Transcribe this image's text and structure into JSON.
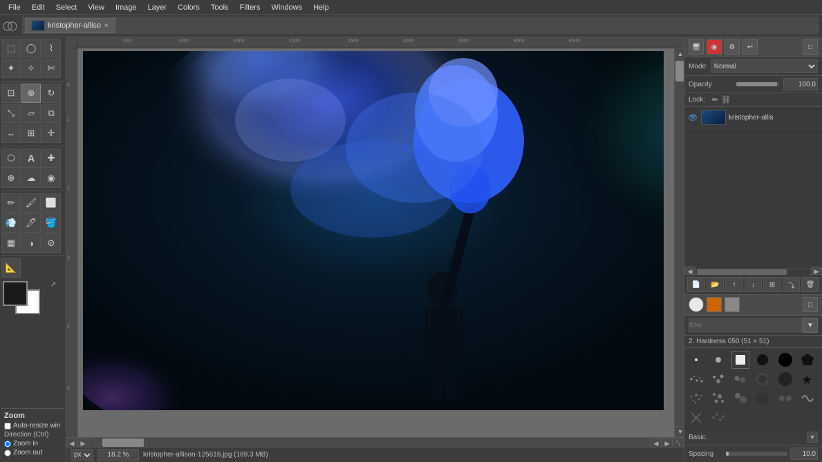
{
  "menubar": {
    "items": [
      "File",
      "Edit",
      "Select",
      "View",
      "Image",
      "Layer",
      "Colors",
      "Tools",
      "Filters",
      "Windows",
      "Help"
    ]
  },
  "toptoolbar": {
    "logo": "⬤",
    "tab": {
      "name": "kristopher-alliso",
      "close": "✕"
    }
  },
  "toolbox": {
    "tools": [
      {
        "id": "rect-select",
        "icon": "⬚"
      },
      {
        "id": "ellipse-select",
        "icon": "○"
      },
      {
        "id": "lasso",
        "icon": "⌇"
      },
      {
        "id": "fuzzy-select",
        "icon": "✦"
      },
      {
        "id": "color-select",
        "icon": "✧"
      },
      {
        "id": "crop",
        "icon": "⊡"
      },
      {
        "id": "rotate",
        "icon": "↻"
      },
      {
        "id": "scale",
        "icon": "⤡"
      },
      {
        "id": "perspective",
        "icon": "▱"
      },
      {
        "id": "flip",
        "icon": "⇔"
      },
      {
        "id": "text",
        "icon": "A"
      },
      {
        "id": "pencil",
        "icon": "✏"
      },
      {
        "id": "brush",
        "icon": "🖌"
      },
      {
        "id": "eraser",
        "icon": "⬜"
      },
      {
        "id": "fill",
        "icon": "🪣"
      },
      {
        "id": "gradient",
        "icon": "▦"
      },
      {
        "id": "heal",
        "icon": "✚"
      },
      {
        "id": "clone",
        "icon": "✲"
      },
      {
        "id": "blur",
        "icon": "◉"
      },
      {
        "id": "dodge",
        "icon": "◑"
      },
      {
        "id": "smudge",
        "icon": "☁"
      },
      {
        "id": "measure",
        "icon": "⬟"
      },
      {
        "id": "zoom",
        "icon": "⊕"
      },
      {
        "id": "hand",
        "icon": "✋"
      },
      {
        "id": "move",
        "icon": "✛"
      },
      {
        "id": "path",
        "icon": "⬡"
      },
      {
        "id": "colorpick",
        "icon": "⊘"
      }
    ],
    "fgColor": "#1a1a1a",
    "bgColor": "#ffffff"
  },
  "zoom": {
    "title": "Zoom",
    "autoresize_label": "Auto-resize win",
    "direction_label": "Direction  (Ctrl)",
    "zoom_in_label": "Zoom in",
    "zoom_out_label": "Zoom out"
  },
  "ruler": {
    "ticks": [
      "500",
      "1000",
      "1500",
      "2000",
      "2500",
      "3000",
      "3500",
      "4000",
      "4500"
    ]
  },
  "bottombar": {
    "unit": "px",
    "zoom": "18.2 %",
    "filename": "kristopher-allison-125616.jpg (189.3 MB)"
  },
  "rightpanel": {
    "mode_label": "Mode:",
    "mode_value": "Normal",
    "opacity_label": "Opacity",
    "opacity_value": "100.0",
    "lock_label": "Lock:",
    "layer_name": "kristopher-allis",
    "layers_scroll_left": "◀",
    "layers_scroll_right": "▶",
    "layer_tools": [
      "📄",
      "📂",
      "⬆",
      "⬇",
      "📋",
      "⬇",
      "🗑"
    ],
    "brushes": {
      "filter_placeholder": "filter",
      "info": "2. Hardness 050 (51 × 51)",
      "set_label": "Basic.",
      "spacing_label": "Spacing",
      "spacing_value": "10.0",
      "expand_icon": "▼"
    }
  },
  "icons": {
    "eye": "👁",
    "pencil_lock": "✏",
    "chain_lock": "⛓",
    "panel_icons": [
      "🖥",
      "🔴",
      "🔧",
      "↪"
    ],
    "scroll_left": "◀",
    "scroll_right": "▶",
    "layer_btns": [
      "📄",
      "📂",
      "↑",
      "↓",
      "⊞",
      "↓",
      "🗑"
    ]
  }
}
